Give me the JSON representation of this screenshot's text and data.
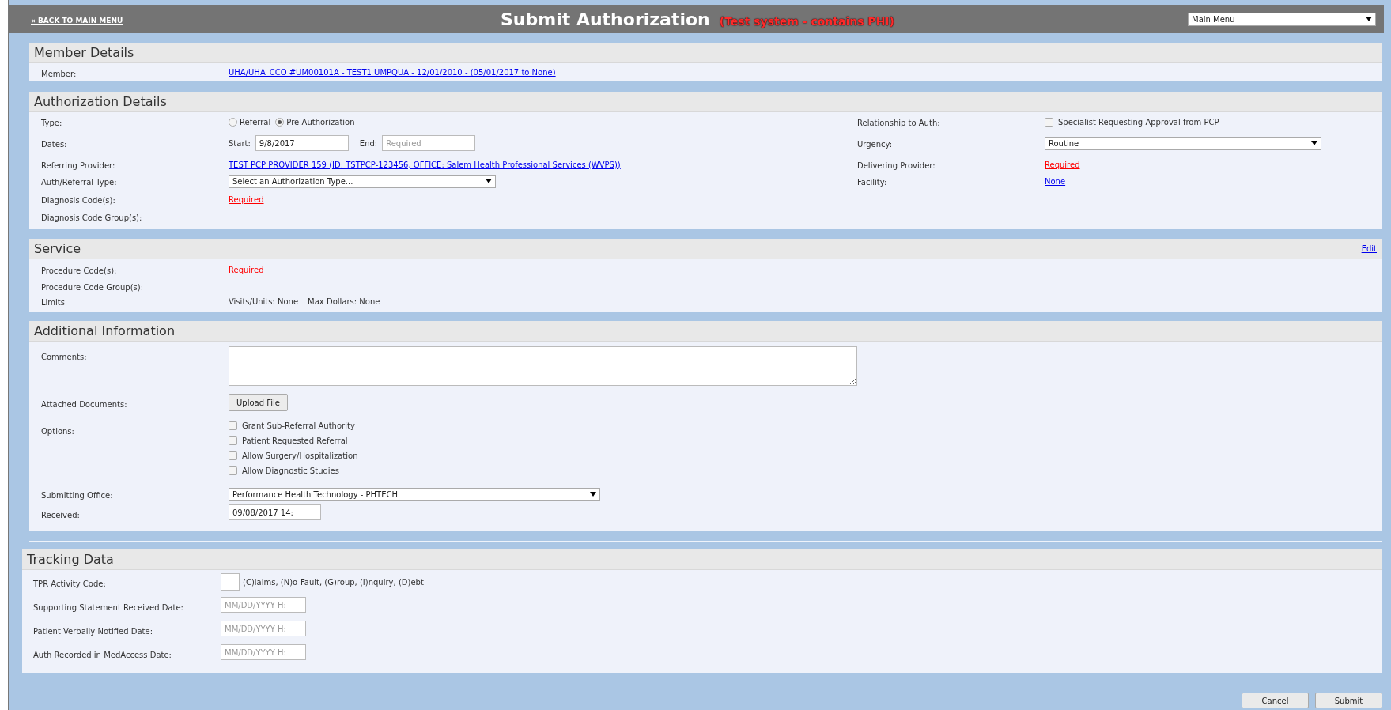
{
  "header": {
    "back_link": "« BACK TO MAIN MENU",
    "title": "Submit Authorization",
    "notice": "(Test system - contains PHI)",
    "menu_select": "Main Menu"
  },
  "member_details": {
    "title": "Member Details",
    "member": {
      "label": "Member:",
      "value": "UHA/UHA_CCO #UM00101A - TEST1 UMPQUA - 12/01/2010 - (05/01/2017 to None)"
    }
  },
  "authorization_details": {
    "title": "Authorization Details",
    "type": {
      "label": "Type:",
      "options": [
        {
          "label": "Referral",
          "selected": false
        },
        {
          "label": "Pre-Authorization",
          "selected": true
        }
      ]
    },
    "dates": {
      "label": "Dates:",
      "start_label": "Start:",
      "start_value": "9/8/2017",
      "end_label": "End:",
      "end_placeholder": "Required"
    },
    "referring_provider": {
      "label": "Referring Provider:",
      "value": "TEST PCP PROVIDER 159 (ID: TSTPCP-123456, OFFICE: Salem Health Professional Services (WVPS))"
    },
    "auth_type": {
      "label": "Auth/Referral Type:",
      "value": "Select an Authorization Type..."
    },
    "diagnosis_codes": {
      "label": "Diagnosis Code(s):",
      "value": "Required"
    },
    "diagnosis_code_groups": {
      "label": "Diagnosis Code Group(s):"
    },
    "relationship": {
      "label": "Relationship to Auth:",
      "option": {
        "label": "Specialist Requesting Approval from PCP",
        "checked": false
      }
    },
    "urgency": {
      "label": "Urgency:",
      "value": "Routine"
    },
    "delivering_provider": {
      "label": "Delivering Provider:",
      "value": "Required"
    },
    "facility": {
      "label": "Facility:",
      "value": "None"
    }
  },
  "service": {
    "title": "Service",
    "edit_link": "Edit",
    "procedure_codes": {
      "label": "Procedure Code(s):",
      "value": "Required"
    },
    "procedure_code_groups": {
      "label": "Procedure Code Group(s):"
    },
    "limits": {
      "label": "Limits",
      "visits": "Visits/Units: None",
      "max_dollars": "Max Dollars: None"
    }
  },
  "additional_information": {
    "title": "Additional Information",
    "comments": {
      "label": "Comments:"
    },
    "attached_documents": {
      "label": "Attached Documents:",
      "button": "Upload File"
    },
    "options": {
      "label": "Options:",
      "items": [
        {
          "label": "Grant Sub-Referral Authority",
          "checked": false
        },
        {
          "label": "Patient Requested Referral",
          "checked": false
        },
        {
          "label": "Allow Surgery/Hospitalization",
          "checked": false
        },
        {
          "label": "Allow Diagnostic Studies",
          "checked": false
        }
      ]
    },
    "submitting_office": {
      "label": "Submitting Office:",
      "value": "Performance Health Technology - PHTECH"
    },
    "received": {
      "label": "Received:",
      "value": "09/08/2017 14:"
    }
  },
  "tracking_data": {
    "title": "Tracking Data",
    "tpr_activity_code": {
      "label": "TPR Activity Code:",
      "hint": "(C)laims, (N)o-Fault, (G)roup, (I)nquiry, (D)ebt"
    },
    "dates": [
      {
        "label": "Supporting Statement Received Date:",
        "placeholder": "MM/DD/YYYY H:"
      },
      {
        "label": "Patient Verbally Notified Date:",
        "placeholder": "MM/DD/YYYY H:"
      },
      {
        "label": "Auth Recorded in MedAccess Date:",
        "placeholder": "MM/DD/YYYY H:"
      }
    ]
  },
  "buttons": [
    "Cancel",
    "Submit"
  ]
}
